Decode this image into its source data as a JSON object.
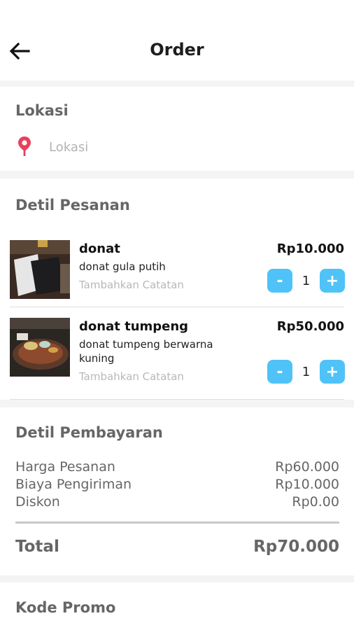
{
  "appbar": {
    "title": "Order",
    "back_icon": "arrow-left-icon"
  },
  "location": {
    "title": "Lokasi",
    "placeholder": "Lokasi",
    "value": "",
    "pin_icon": "location-pin-icon",
    "pin_color": "#e8415a"
  },
  "order": {
    "title": "Detil Pesanan",
    "items": [
      {
        "name": "donat",
        "description": "donat gula putih",
        "note_label": "Tambahkan Catatan",
        "price": "Rp10.000",
        "quantity": "1"
      },
      {
        "name": "donat tumpeng",
        "description": "donat tumpeng berwarna kuning",
        "note_label": "Tambahkan Catatan",
        "price": "Rp50.000",
        "quantity": "1"
      }
    ],
    "minus_label": "-",
    "plus_label": "+",
    "accent_color": "#4fc3f7"
  },
  "payment": {
    "title": "Detil Pembayaran",
    "rows": [
      {
        "label": "Harga Pesanan",
        "value": "Rp60.000"
      },
      {
        "label": "Biaya Pengiriman",
        "value": "Rp10.000"
      },
      {
        "label": "Diskon",
        "value": "Rp0.00"
      }
    ],
    "total_label": "Total",
    "total_value": "Rp70.000"
  },
  "promo": {
    "title": "Kode Promo"
  }
}
